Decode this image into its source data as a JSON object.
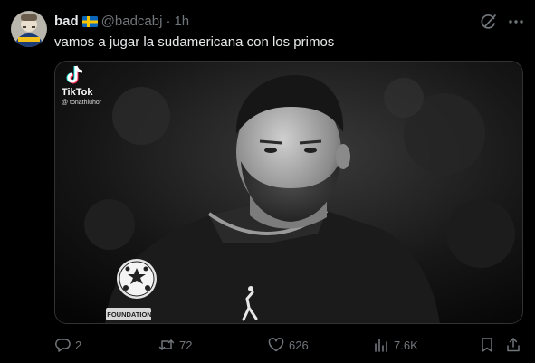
{
  "author": {
    "display_name": "bad",
    "handle": "@badcabj",
    "separator": "·",
    "time": "1h",
    "avatar_icon": "avatar-image",
    "flag_icon": "sweden-flag-icon"
  },
  "tweet": {
    "text": "vamos a jugar la sudamericana con los primos"
  },
  "media": {
    "watermark_brand": "TikTok",
    "watermark_user": "@ tonathiuhor",
    "patch_text": "FOUNDATION"
  },
  "actions": {
    "replies": "2",
    "reposts": "72",
    "likes": "626",
    "views": "7.6K"
  },
  "colors": {
    "background": "#000000",
    "text": "#e7e9ea",
    "muted": "#71767b",
    "border": "#2f3336"
  }
}
